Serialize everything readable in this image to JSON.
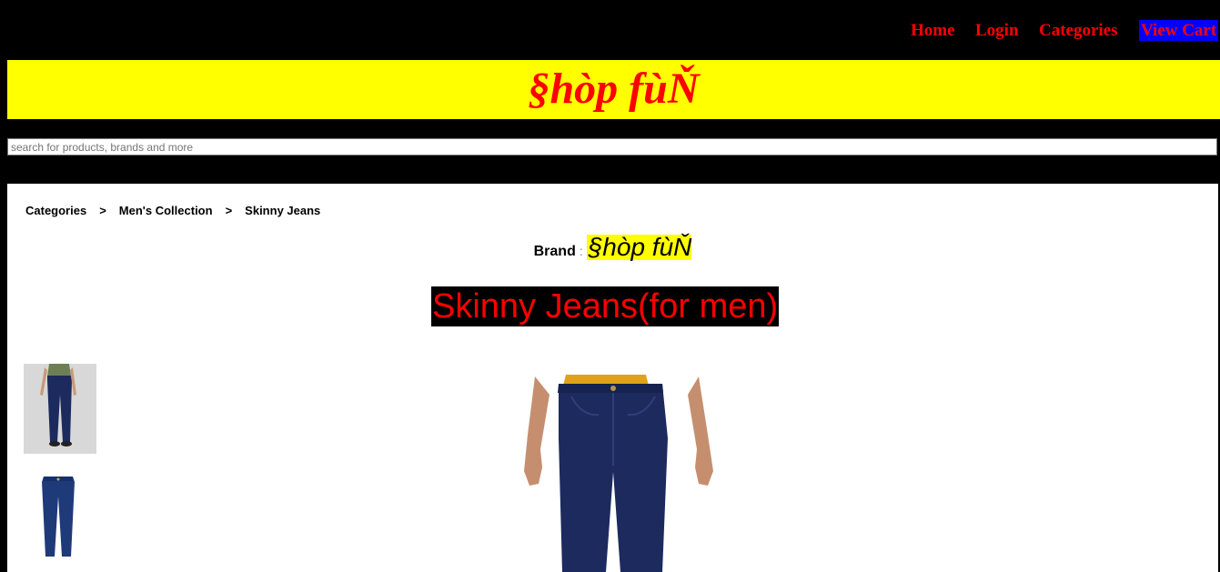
{
  "nav": {
    "home": "Home",
    "login": "Login",
    "categories": "Categories",
    "view_cart": "View Cart"
  },
  "banner": {
    "title": "§hòp fùŇ"
  },
  "search": {
    "placeholder": "search for products, brands and more"
  },
  "breadcrumb": {
    "items": [
      "Categories",
      "Men's Collection",
      "Skinny Jeans"
    ],
    "separator": ">"
  },
  "brand": {
    "label": "Brand",
    "colon": ":",
    "name": "§hòp fùŇ"
  },
  "product": {
    "title": "Skinny Jeans(for men)"
  },
  "colors": {
    "accent_red": "#ff0000",
    "banner_yellow": "#ffff00",
    "cart_blue": "#0000ff",
    "denim": "#1c2a5e",
    "shirt_yellow": "#e0a21a"
  }
}
